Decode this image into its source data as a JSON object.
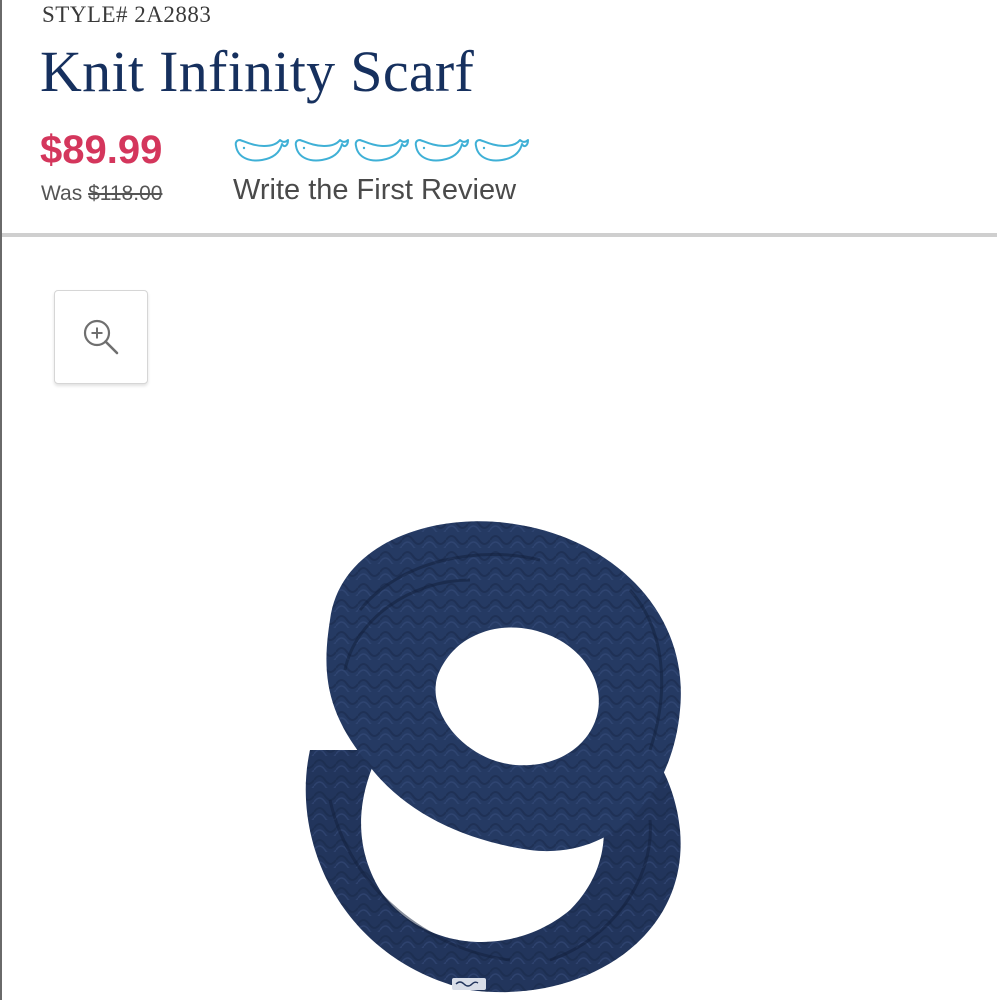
{
  "product": {
    "style_number": "STYLE# 2A2883",
    "title": "Knit Infinity Scarf",
    "sale_price": "$89.99",
    "was_label": "Was",
    "original_price": "$118.00"
  },
  "reviews": {
    "rating_stars": 5,
    "rating_value": 0,
    "star_icon": "whale-outline-icon",
    "write_review_label": "Write the First Review"
  },
  "gallery": {
    "zoom_icon": "zoom-in-icon",
    "image_subject": "navy cable-knit infinity scarf"
  },
  "colors": {
    "title": "#16305e",
    "sale_price": "#d4365c",
    "rating_outline": "#3fb0d6",
    "product": "#22355c"
  }
}
